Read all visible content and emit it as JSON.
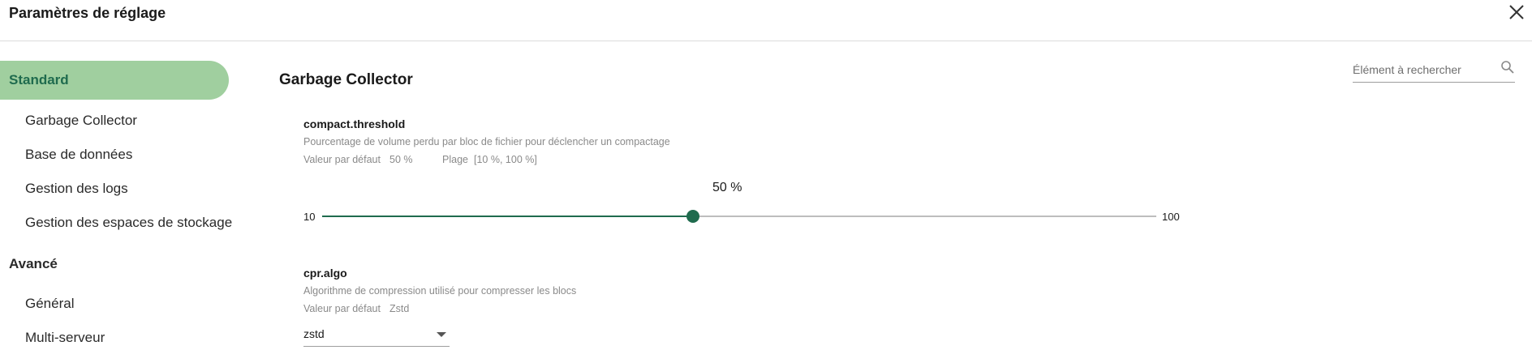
{
  "header": {
    "title": "Paramètres de réglage",
    "close_icon": "close-icon"
  },
  "sidebar": {
    "groups": [
      {
        "label": "Standard",
        "active": true,
        "items": [
          {
            "label": "Garbage Collector"
          },
          {
            "label": "Base de données"
          },
          {
            "label": "Gestion des logs"
          },
          {
            "label": "Gestion des espaces de stockage"
          }
        ]
      },
      {
        "label": "Avancé",
        "active": false,
        "items": [
          {
            "label": "Général"
          },
          {
            "label": "Multi-serveur"
          }
        ]
      }
    ]
  },
  "main": {
    "section_title": "Garbage Collector",
    "search": {
      "placeholder": "Élément à rechercher",
      "icon": "search-icon"
    },
    "params": [
      {
        "name": "compact.threshold",
        "description": "Pourcentage de volume perdu par bloc de fichier pour déclencher un compactage",
        "default_label": "Valeur par défaut",
        "default_value": "50 %",
        "range_label": "Plage",
        "range_value": "[10 %, 100 %]",
        "slider": {
          "value_text": "50 %",
          "value": 50,
          "min": 10,
          "max": 100,
          "min_label": "10",
          "max_label": "100"
        }
      },
      {
        "name": "cpr.algo",
        "description": "Algorithme de compression utilisé pour compresser les blocs",
        "default_label": "Valeur par défaut",
        "default_value": "Zstd",
        "select": {
          "value": "zstd",
          "icon": "chevron-down-icon"
        }
      }
    ]
  },
  "colors": {
    "accent": "#1f6b4e",
    "active_background": "#a0cf9f",
    "track": "#bdbdbd",
    "muted_text": "#8a8a8a"
  }
}
